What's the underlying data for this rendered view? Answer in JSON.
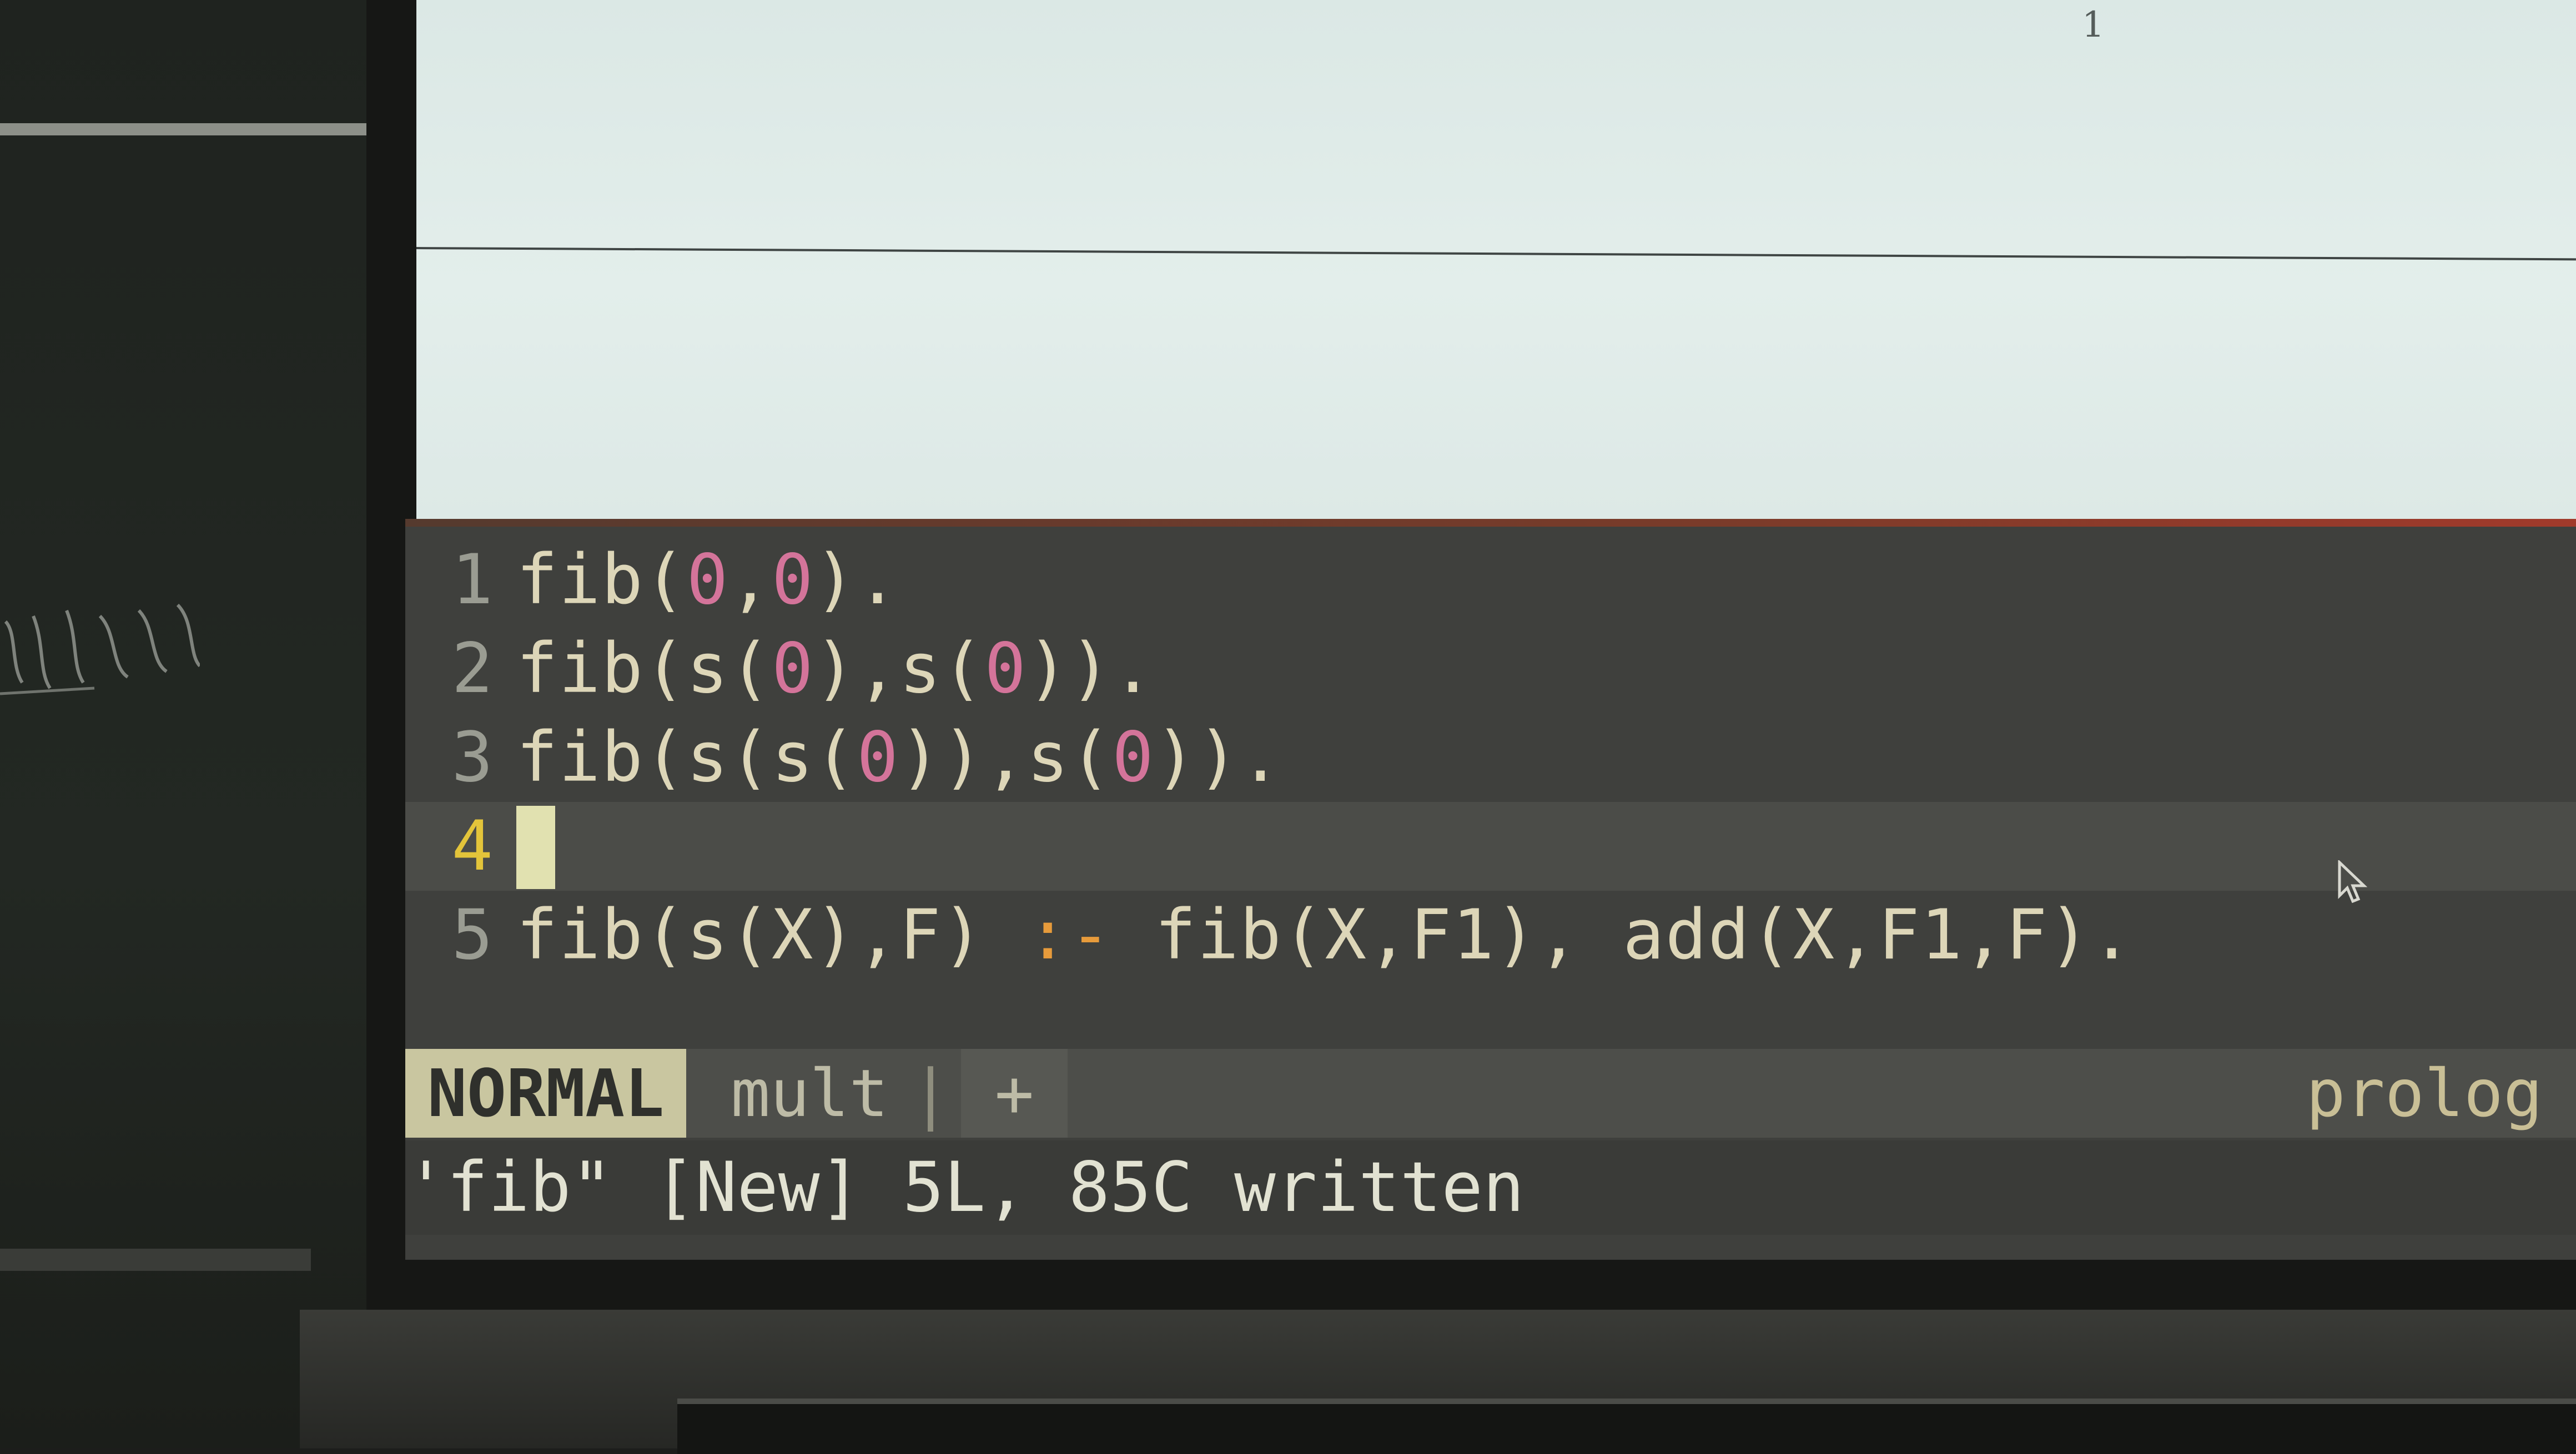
{
  "document": {
    "page_number": "1"
  },
  "editor": {
    "lines": [
      {
        "number": "1",
        "parts": [
          {
            "t": "fib("
          },
          {
            "t": "0",
            "n": true
          },
          {
            "t": ","
          },
          {
            "t": "0",
            "n": true
          },
          {
            "t": ")."
          }
        ]
      },
      {
        "number": "2",
        "parts": [
          {
            "t": "fib(s("
          },
          {
            "t": "0",
            "n": true
          },
          {
            "t": "),s("
          },
          {
            "t": "0",
            "n": true
          },
          {
            "t": "))."
          }
        ]
      },
      {
        "number": "3",
        "parts": [
          {
            "t": "fib(s(s("
          },
          {
            "t": "0",
            "n": true
          },
          {
            "t": ")),s("
          },
          {
            "t": "0",
            "n": true
          },
          {
            "t": "))."
          }
        ]
      },
      {
        "number": "4",
        "parts": [],
        "current": true
      },
      {
        "number": "5",
        "parts": [
          {
            "t": "fib(s(X),F) "
          },
          {
            "t": ":-",
            "o": true
          },
          {
            "t": " fib(X,F1), add(X,F1,F)."
          }
        ]
      }
    ]
  },
  "statusline": {
    "mode": "NORMAL",
    "filename": "mult",
    "separator": "|",
    "modified": "+",
    "filetype": "prolog"
  },
  "commandline": {
    "message": "'fib\" [New] 5L, 85C written"
  },
  "colors": {
    "editor_bg": "#3f403d",
    "number_literal": "#d4749a",
    "operator": "#e79b3b",
    "current_line_number": "#e3c43a",
    "mode_badge_bg": "#c9c6a0"
  }
}
